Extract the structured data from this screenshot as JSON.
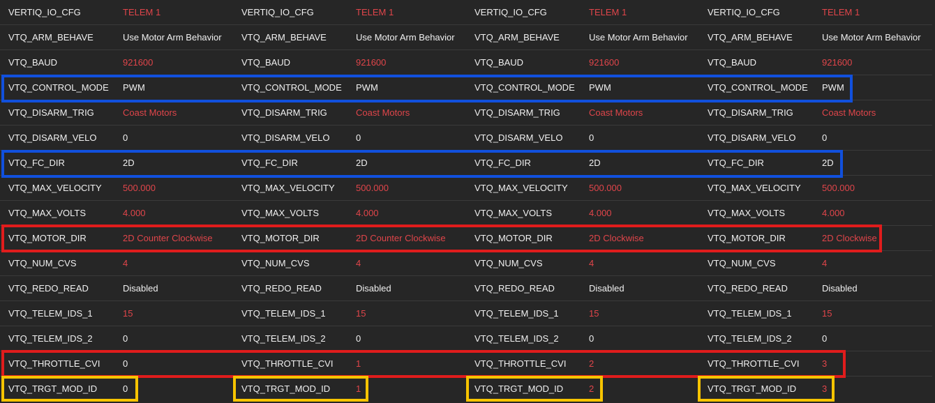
{
  "params": [
    {
      "name": "VERTIQ_IO_CFG",
      "values": [
        "TELEM 1",
        "TELEM 1",
        "TELEM 1",
        "TELEM 1"
      ],
      "colors": [
        "red",
        "red",
        "red",
        "red"
      ]
    },
    {
      "name": "VTQ_ARM_BEHAVE",
      "values": [
        "Use Motor Arm Behavior",
        "Use Motor Arm Behavior",
        "Use Motor Arm Behavior",
        "Use Motor Arm Behavior"
      ],
      "colors": [
        "white",
        "white",
        "white",
        "white"
      ]
    },
    {
      "name": "VTQ_BAUD",
      "values": [
        "921600",
        "921600",
        "921600",
        "921600"
      ],
      "colors": [
        "red",
        "red",
        "red",
        "red"
      ]
    },
    {
      "name": "VTQ_CONTROL_MODE",
      "values": [
        "PWM",
        "PWM",
        "PWM",
        "PWM"
      ],
      "colors": [
        "white",
        "white",
        "white",
        "white"
      ]
    },
    {
      "name": "VTQ_DISARM_TRIG",
      "values": [
        "Coast Motors",
        "Coast Motors",
        "Coast Motors",
        "Coast Motors"
      ],
      "colors": [
        "red",
        "red",
        "red",
        "red"
      ]
    },
    {
      "name": "VTQ_DISARM_VELO",
      "values": [
        "0",
        "0",
        "0",
        "0"
      ],
      "colors": [
        "white",
        "white",
        "white",
        "white"
      ]
    },
    {
      "name": "VTQ_FC_DIR",
      "values": [
        "2D",
        "2D",
        "2D",
        "2D"
      ],
      "colors": [
        "white",
        "white",
        "white",
        "white"
      ]
    },
    {
      "name": "VTQ_MAX_VELOCITY",
      "values": [
        "500.000",
        "500.000",
        "500.000",
        "500.000"
      ],
      "colors": [
        "red",
        "red",
        "red",
        "red"
      ]
    },
    {
      "name": "VTQ_MAX_VOLTS",
      "values": [
        "4.000",
        "4.000",
        "4.000",
        "4.000"
      ],
      "colors": [
        "red",
        "red",
        "red",
        "red"
      ]
    },
    {
      "name": "VTQ_MOTOR_DIR",
      "values": [
        "2D Counter Clockwise",
        "2D Counter Clockwise",
        "2D Clockwise",
        "2D Clockwise"
      ],
      "colors": [
        "red",
        "red",
        "red",
        "red"
      ]
    },
    {
      "name": "VTQ_NUM_CVS",
      "values": [
        "4",
        "4",
        "4",
        "4"
      ],
      "colors": [
        "red",
        "red",
        "red",
        "red"
      ]
    },
    {
      "name": "VTQ_REDO_READ",
      "values": [
        "Disabled",
        "Disabled",
        "Disabled",
        "Disabled"
      ],
      "colors": [
        "white",
        "white",
        "white",
        "white"
      ]
    },
    {
      "name": "VTQ_TELEM_IDS_1",
      "values": [
        "15",
        "15",
        "15",
        "15"
      ],
      "colors": [
        "red",
        "red",
        "red",
        "red"
      ]
    },
    {
      "name": "VTQ_TELEM_IDS_2",
      "values": [
        "0",
        "0",
        "0",
        "0"
      ],
      "colors": [
        "white",
        "white",
        "white",
        "white"
      ]
    },
    {
      "name": "VTQ_THROTTLE_CVI",
      "values": [
        "0",
        "1",
        "2",
        "3"
      ],
      "colors": [
        "white",
        "red",
        "red",
        "red"
      ]
    },
    {
      "name": "VTQ_TRGT_MOD_ID",
      "values": [
        "0",
        "1",
        "2",
        "3"
      ],
      "colors": [
        "white",
        "red",
        "red",
        "red"
      ]
    }
  ],
  "colors": {
    "background": "#262626",
    "modified_value": "#e0454a",
    "default_value": "#f0f0f0",
    "highlight_blue": "#1150dd",
    "highlight_red": "#e01c1c",
    "highlight_yellow": "#f7c400"
  }
}
